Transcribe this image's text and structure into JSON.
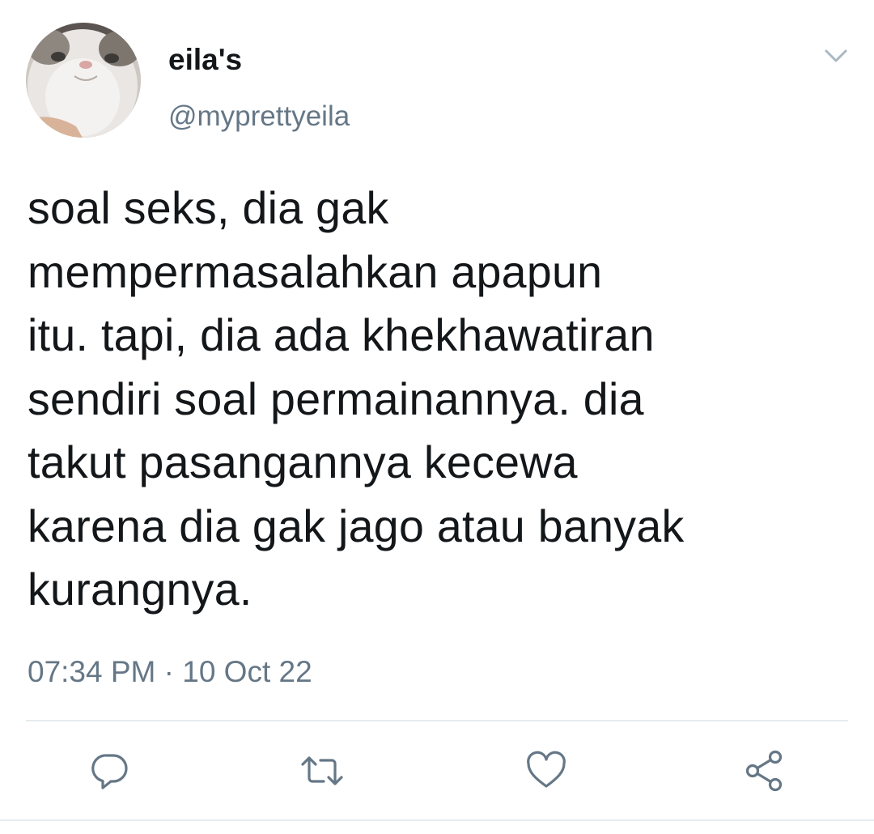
{
  "user": {
    "display_name": "eila's",
    "handle": "@myprettyeila",
    "avatar_icon": "cat-photo-avatar"
  },
  "tweet": {
    "text_lines": [
      "soal seks, dia gak",
      "mempermasalahkan apapun",
      "itu. tapi, dia ada khekhawatiran",
      "sendiri soal permainannya. dia",
      "takut pasangannya kecewa",
      "karena dia gak jago atau banyak",
      "kurangnya."
    ],
    "timestamp": "07:34 PM · 10 Oct 22"
  },
  "actions": {
    "reply_icon": "reply-icon",
    "retweet_icon": "retweet-icon",
    "like_icon": "heart-icon",
    "share_icon": "share-icon",
    "menu_icon": "chevron-down-icon"
  },
  "colors": {
    "text": "#14171a",
    "secondary": "#657786",
    "icon": "#657786",
    "divider": "#e6ecf0"
  }
}
